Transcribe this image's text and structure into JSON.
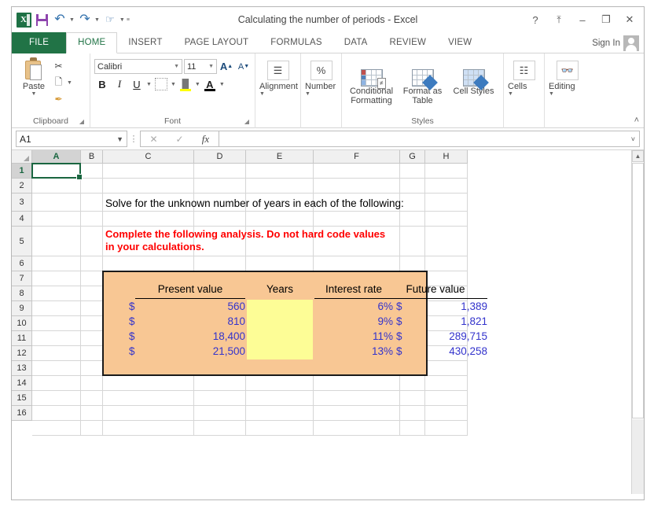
{
  "window": {
    "title": "Calculating the number of periods - Excel",
    "app_logo": "X",
    "quick_access": [
      {
        "name": "save-icon",
        "label": "Save"
      },
      {
        "name": "undo-icon",
        "label": "Undo"
      },
      {
        "name": "redo-icon",
        "label": "Redo"
      },
      {
        "name": "touch-mode-icon",
        "label": "Touch/Mouse Mode"
      },
      {
        "name": "customize-qat-icon",
        "label": "Customize Quick Access Toolbar"
      }
    ],
    "controls": {
      "help": "?",
      "ribbon_display": "⤒",
      "minimize": "–",
      "restore": "❐",
      "close": "✕"
    },
    "sign_in": "Sign In"
  },
  "ribbon": {
    "tabs": [
      {
        "label": "FILE",
        "active": false,
        "file": true
      },
      {
        "label": "HOME",
        "active": true
      },
      {
        "label": "INSERT",
        "active": false
      },
      {
        "label": "PAGE LAYOUT",
        "active": false
      },
      {
        "label": "FORMULAS",
        "active": false
      },
      {
        "label": "DATA",
        "active": false
      },
      {
        "label": "REVIEW",
        "active": false
      },
      {
        "label": "VIEW",
        "active": false
      }
    ],
    "groups": {
      "clipboard": {
        "label": "Clipboard",
        "paste": "Paste",
        "cut": "Cut",
        "copy": "Copy",
        "format_painter": "Format Painter"
      },
      "font": {
        "label": "Font",
        "font_name": "Calibri",
        "font_size": "11",
        "grow_font": "A",
        "shrink_font": "A",
        "bold": "B",
        "italic": "I",
        "underline": "U",
        "borders": "Borders",
        "fill_color": "Fill Color",
        "font_color": "A"
      },
      "alignment": {
        "label": "Alignment"
      },
      "number": {
        "label": "Number",
        "icon": "%"
      },
      "styles": {
        "label": "Styles",
        "conditional_formatting": "Conditional Formatting",
        "format_as_table": "Format as Table",
        "cell_styles": "Cell Styles"
      },
      "cells": {
        "label": "Cells"
      },
      "editing": {
        "label": "Editing"
      }
    },
    "collapse": "˄"
  },
  "formula_bar": {
    "name_box": "A1",
    "cancel": "✕",
    "enter": "✓",
    "function": "fx",
    "value": "",
    "expand": "˅"
  },
  "grid": {
    "columns": [
      "A",
      "B",
      "C",
      "D",
      "E",
      "F",
      "G",
      "H"
    ],
    "selected_column": "A",
    "rows": [
      "1",
      "2",
      "3",
      "4",
      "5",
      "6",
      "7",
      "8",
      "9",
      "10",
      "11",
      "12",
      "13",
      "14",
      "15",
      "16"
    ],
    "selected_row": "1",
    "selected_cell": "A1"
  },
  "worksheet": {
    "instruction": "Solve for the unknown number of years in each of the following:",
    "warning_line1": "Complete the following analysis. Do not hard code values",
    "warning_line2": "in your calculations.",
    "table": {
      "headers": [
        "Present value",
        "Years",
        "Interest rate",
        "Future value"
      ],
      "rows": [
        {
          "present_value": "560",
          "years": "",
          "interest_rate": "6%",
          "future_value": "1,389",
          "currency": "$"
        },
        {
          "present_value": "810",
          "years": "",
          "interest_rate": "9%",
          "future_value": "1,821",
          "currency": "$"
        },
        {
          "present_value": "18,400",
          "years": "",
          "interest_rate": "11%",
          "future_value": "289,715",
          "currency": "$"
        },
        {
          "present_value": "21,500",
          "years": "",
          "interest_rate": "13%",
          "future_value": "430,258",
          "currency": "$"
        }
      ]
    }
  },
  "colors": {
    "table_fill": "#F8C794",
    "input_fill": "#FDFD96",
    "number_text": "#3333CC",
    "warning_text": "#FF0000",
    "excel_green": "#217346"
  },
  "scrollbar": {
    "up": "▲"
  }
}
